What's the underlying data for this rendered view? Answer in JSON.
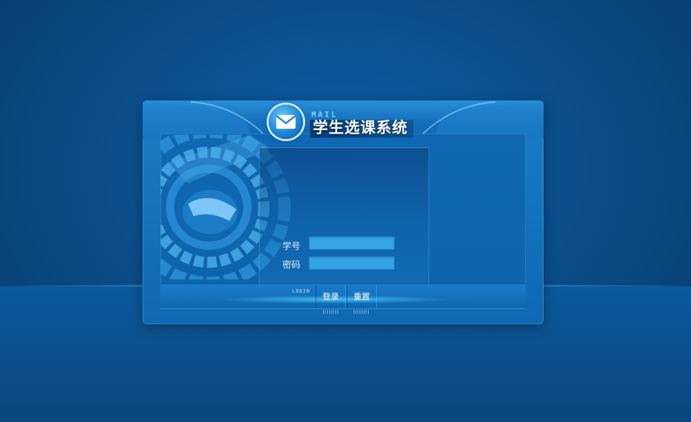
{
  "app": {
    "mail_label": "MAIL",
    "title": "学生选课系统"
  },
  "form": {
    "student_id_label": "学号",
    "student_id_value": "",
    "password_label": "密码",
    "password_value": ""
  },
  "footer": {
    "login_tag": "LOGIN",
    "login_button": "登录",
    "reset_button": "重置"
  },
  "icons": {
    "logo": "mail-envelope-icon",
    "decoration": "radar-dish-graphic"
  },
  "colors": {
    "background": "#0a4f8c",
    "panel": "#1673bd",
    "input_fill": "#35a4e6",
    "title_text": "#ffffff"
  }
}
